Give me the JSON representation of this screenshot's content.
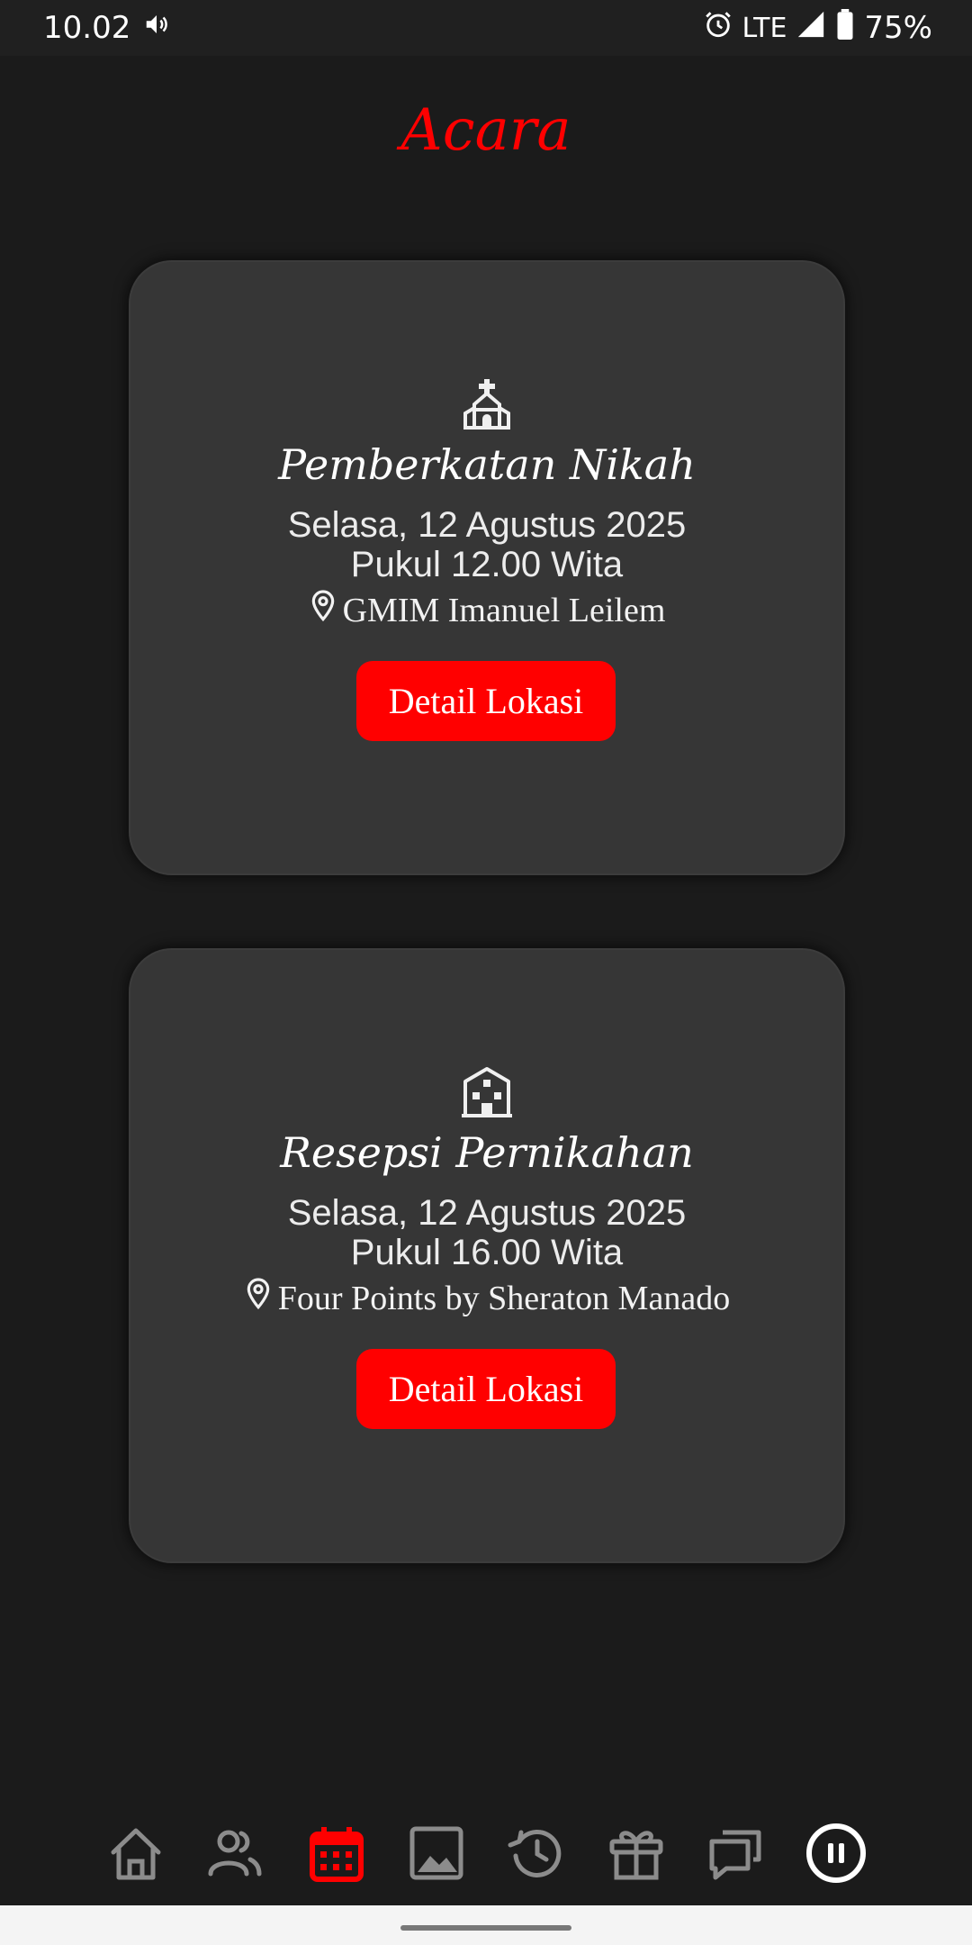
{
  "status_bar": {
    "time": "10.02",
    "network": "LTE",
    "battery": "75%"
  },
  "page": {
    "title": "Acara"
  },
  "events": [
    {
      "icon": "church-icon",
      "name": "Pemberkatan Nikah",
      "date": "Selasa, 12 Agustus 2025",
      "time": "Pukul 12.00 Wita",
      "venue": "GMIM Imanuel Leilem",
      "button_label": "Detail Lokasi"
    },
    {
      "icon": "building-icon",
      "name": "Resepsi Pernikahan",
      "date": "Selasa, 12 Agustus 2025",
      "time": "Pukul 16.00 Wita",
      "venue": "Four Points by Sheraton Manado",
      "button_label": "Detail Lokasi"
    }
  ],
  "bottom_nav": {
    "items": [
      "home-icon",
      "users-icon",
      "calendar-icon",
      "gallery-icon",
      "history-icon",
      "gift-icon",
      "chat-icon",
      "pause-icon"
    ],
    "active": "calendar-icon"
  },
  "colors": {
    "accent": "#ff0000",
    "background": "#1b1b1b",
    "card": "#363636",
    "nav_icon": "#8c8c8c"
  }
}
